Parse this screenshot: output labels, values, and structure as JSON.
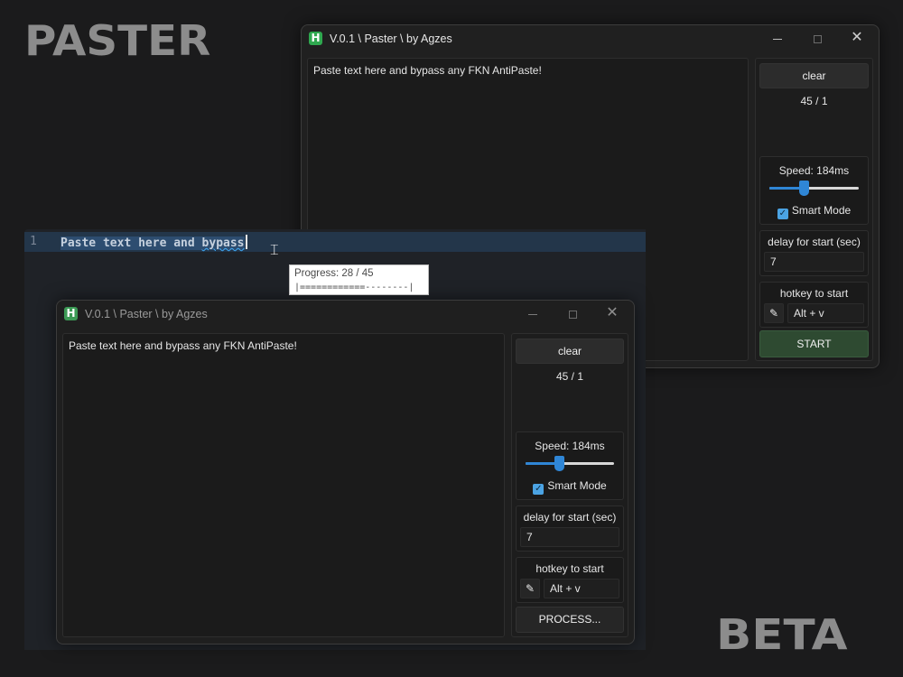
{
  "branding": {
    "title": "PASTER",
    "beta": "BETA"
  },
  "window_back": {
    "icon_letter": "H",
    "title": "V.0.1 \\ Paster \\ by Agzes",
    "text": "Paste text here and bypass any FKN AntiPaste!",
    "clear_label": "clear",
    "counter": "45 / 1",
    "speed_label": "Speed: 184ms",
    "speed_level": 0.38,
    "smart_mode_label": "Smart Mode",
    "smart_mode_checked": true,
    "delay_label": "delay for start (sec)",
    "delay_value": "7",
    "hotkey_label": "hotkey to start",
    "hotkey_value": "Alt + v",
    "action_label": "START"
  },
  "editor": {
    "line_number": "1",
    "text_plain": "Paste text here and ",
    "text_squiggle": "bypass"
  },
  "tooltip": {
    "progress": "Progress: 28 / 45",
    "bar": "|============--------|"
  },
  "window_front": {
    "icon_letter": "H",
    "title": "V.0.1 \\ Paster \\ by Agzes",
    "text": "Paste text here and bypass any FKN AntiPaste!",
    "clear_label": "clear",
    "counter": "45 / 1",
    "speed_label": "Speed: 184ms",
    "speed_level": 0.38,
    "smart_mode_label": "Smart Mode",
    "smart_mode_checked": true,
    "delay_label": "delay for start (sec)",
    "delay_value": "7",
    "hotkey_label": "hotkey to start",
    "hotkey_value": "Alt + v",
    "action_label": "PROCESS..."
  },
  "colors": {
    "background": "#1b1b1c",
    "accent_blue": "#2f86d6",
    "start_green": "#2e4a31",
    "app_icon_green": "#2fa84f"
  }
}
